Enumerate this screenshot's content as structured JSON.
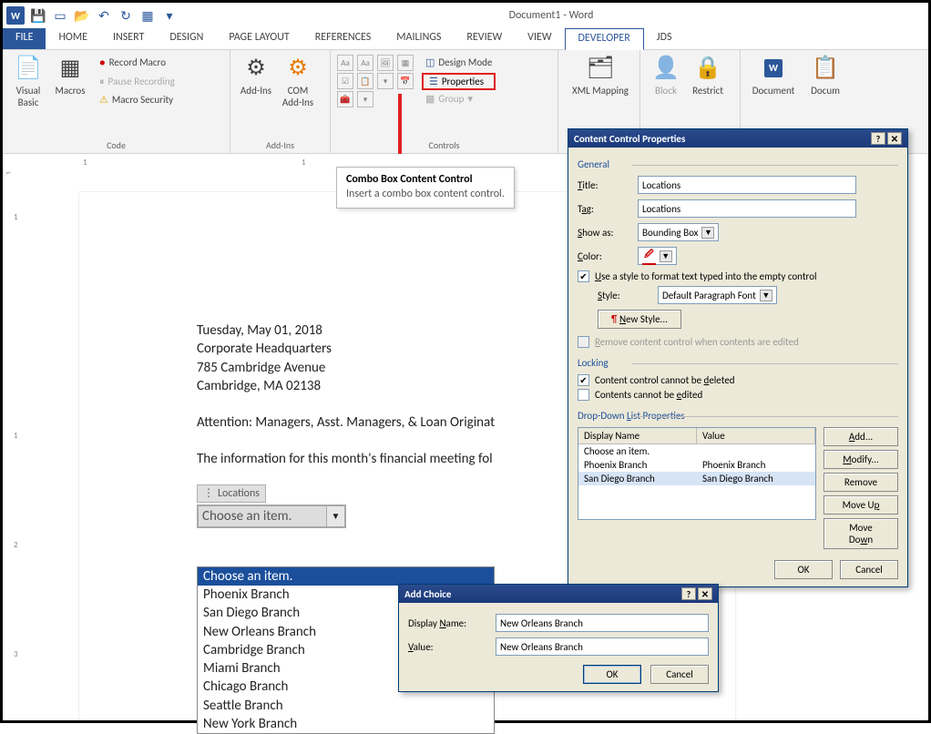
{
  "window": {
    "title": "Document1 - Word"
  },
  "qat": {
    "save": "💾",
    "undo": "↶",
    "redo": "↻",
    "custom": "⋯"
  },
  "tabs": [
    "FILE",
    "HOME",
    "INSERT",
    "DESIGN",
    "PAGE LAYOUT",
    "REFERENCES",
    "MAILINGS",
    "REVIEW",
    "VIEW",
    "DEVELOPER",
    "JDS"
  ],
  "ribbon": {
    "code": {
      "vb": "Visual Basic",
      "macros": "Macros",
      "record": "Record Macro",
      "pause": "Pause Recording",
      "security": "Macro Security",
      "label": "Code"
    },
    "addins": {
      "addins": "Add-Ins",
      "com": "COM Add-Ins",
      "label": "Add-Ins"
    },
    "controls": {
      "design": "Design Mode",
      "properties": "Properties",
      "group": "Group",
      "label": "Controls"
    },
    "mapping": {
      "xml": "XML Mapping"
    },
    "protect": {
      "block": "Block",
      "restrict": "Restrict"
    },
    "templates": {
      "doc": "Document",
      "doc2": "Docum"
    }
  },
  "tooltip": {
    "title": "Combo Box Content Control",
    "body": "Insert a combo box content control."
  },
  "document": {
    "date": "Tuesday, May 01, 2018",
    "line1": "Corporate Headquarters",
    "line2": "785 Cambridge Avenue",
    "line3": "Cambridge, MA 02138",
    "attn": "Attention: Managers, Asst. Managers, & Loan Originat",
    "info": "The information for this month's financial meeting fol",
    "cc_label": "Locations",
    "cc_value": "Choose an item.",
    "options": [
      "Choose an item.",
      "Phoenix Branch",
      "San Diego Branch",
      "New Orleans Branch",
      "Cambridge Branch",
      "Miami Branch",
      "Chicago Branch",
      "Seattle Branch",
      "New York Branch"
    ]
  },
  "ccprops": {
    "title": "Content Control Properties",
    "general": "General",
    "title_label": "Title:",
    "title_val": "Locations",
    "tag_label": "Tag:",
    "tag_val": "Locations",
    "showas_label": "Show as:",
    "showas_val": "Bounding Box",
    "color_label": "Color:",
    "style_check": "Use a style to format text typed into the empty control",
    "style_label": "Style:",
    "style_val": "Default Paragraph Font",
    "newstyle": "New Style...",
    "remove": "Remove content control when contents are edited",
    "locking": "Locking",
    "lock1": "Content control cannot be deleted",
    "lock2": "Contents cannot be edited",
    "ddprops": "Drop-Down List Properties",
    "col1": "Display Name",
    "col2": "Value",
    "rows": [
      {
        "name": "Choose an item.",
        "value": ""
      },
      {
        "name": "Phoenix Branch",
        "value": "Phoenix Branch"
      },
      {
        "name": "San Diego Branch",
        "value": "San Diego Branch"
      }
    ],
    "add": "Add...",
    "modify": "Modify...",
    "removebtn": "Remove",
    "moveup": "Move Up",
    "movedown": "Move Down",
    "ok": "OK",
    "cancel": "Cancel"
  },
  "addchoice": {
    "title": "Add Choice",
    "name_label": "Display Name:",
    "name_val": "New Orleans Branch",
    "value_label": "Value:",
    "value_val": "New Orleans Branch",
    "ok": "OK",
    "cancel": "Cancel"
  }
}
